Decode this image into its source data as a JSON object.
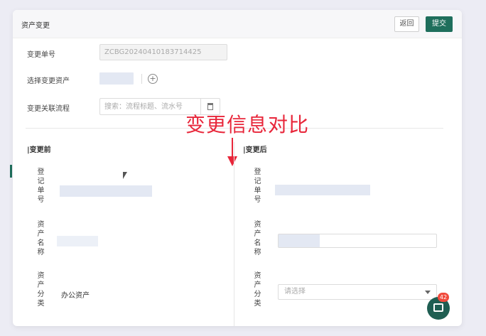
{
  "header": {
    "title": "资产变更",
    "back_label": "返回",
    "submit_label": "提交"
  },
  "form": {
    "change_number_label": "变更单号",
    "change_number_value": "ZCBG20240410183714425",
    "select_asset_label": "选择变更资产",
    "workflow_label": "变更关联流程",
    "workflow_placeholder": "搜索：流程标题、流水号"
  },
  "annotation": {
    "text": "变更信息对比",
    "color": "#e8263a"
  },
  "compare": {
    "before_title": "|变更前",
    "after_title": "|变更后",
    "fields": {
      "register_no": "登记单号",
      "asset_name": "资产名称",
      "asset_category": "资产分类"
    },
    "before_category_value": "办公资产",
    "after_category_placeholder": "请选择"
  },
  "chat": {
    "badge_count": "42"
  },
  "colors": {
    "primary": "#1f6f5c",
    "placeholder_bar": "#e3e8f3",
    "badge": "#f04a3c"
  },
  "icons": {
    "add": "plus-circle-icon",
    "search_button": "document-icon",
    "chat": "chat-icon",
    "dropdown": "chevron-down-icon"
  }
}
